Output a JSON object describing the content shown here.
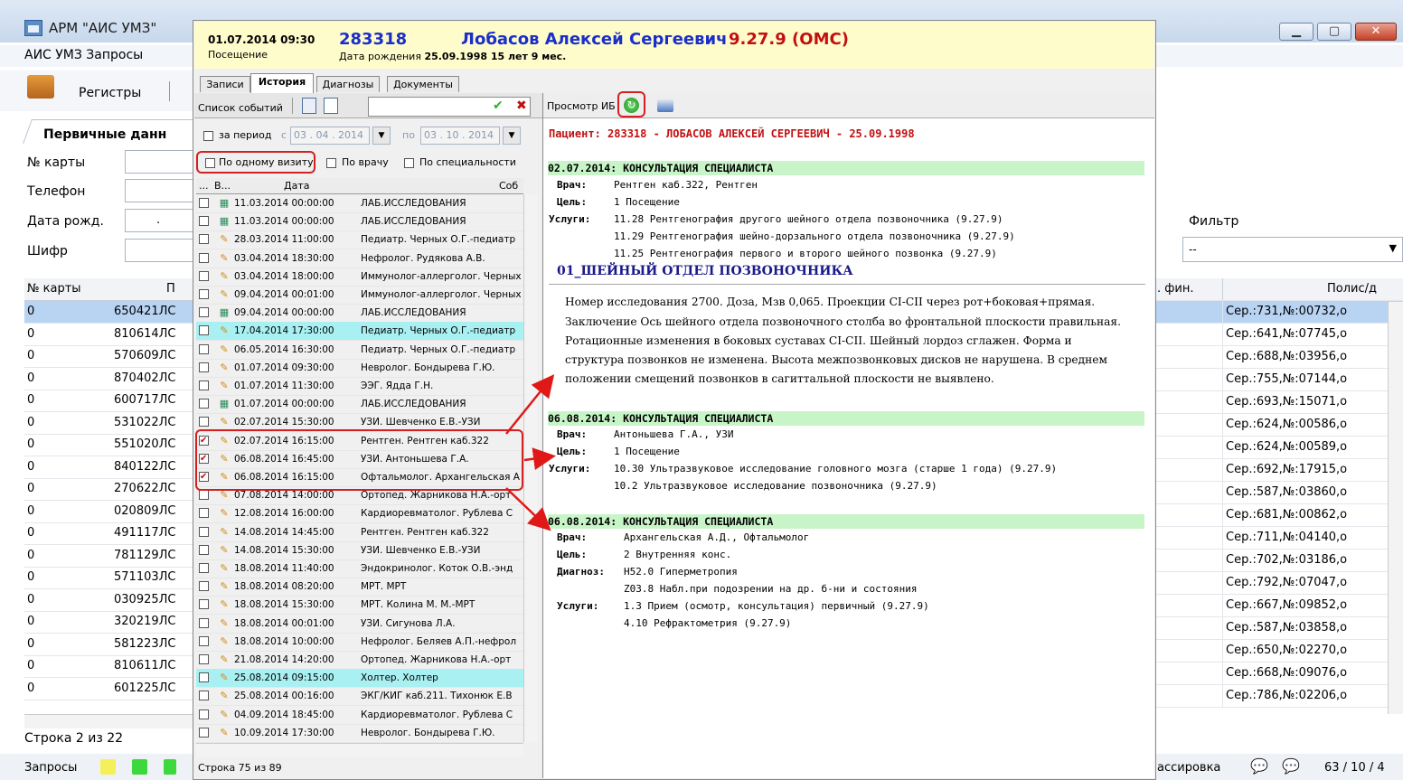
{
  "main_window": {
    "title": "АРМ \"АИС УМЗ\"",
    "menu": "АИС УМЗ  Запросы",
    "toolbar_registry": "Регистры",
    "tab_primary": "Первичные данн",
    "labels": {
      "card": "№ карты",
      "phone": "Телефон",
      "dob": "Дата рожд.",
      "cipher": "Шифр"
    },
    "dob_value": ".",
    "filter_label": "Фильтр",
    "filter_value": "--",
    "grid_headers": {
      "card": "№ карты",
      "pl": "П",
      "fin": ". фин.",
      "policy": "Полис/д"
    },
    "left_rows": [
      {
        "card": "0",
        "code": "650421ЛС",
        "selected": true
      },
      {
        "card": "0",
        "code": "810614ЛС"
      },
      {
        "card": "0",
        "code": "570609ЛС"
      },
      {
        "card": "0",
        "code": "870402ЛС"
      },
      {
        "card": "0",
        "code": "600717ЛС"
      },
      {
        "card": "0",
        "code": "531022ЛС"
      },
      {
        "card": "0",
        "code": "551020ЛС"
      },
      {
        "card": "0",
        "code": "840122ЛС"
      },
      {
        "card": "0",
        "code": "270622ЛС"
      },
      {
        "card": "0",
        "code": "020809ЛС"
      },
      {
        "card": "0",
        "code": "491117ЛС"
      },
      {
        "card": "0",
        "code": "781129ЛС"
      },
      {
        "card": "0",
        "code": "571103ЛС"
      },
      {
        "card": "0",
        "code": "030925ЛС"
      },
      {
        "card": "0",
        "code": "320219ЛС"
      },
      {
        "card": "0",
        "code": "581223ЛС"
      },
      {
        "card": "0",
        "code": "810611ЛС"
      },
      {
        "card": "0",
        "code": "601225ЛС"
      }
    ],
    "policy_rows": [
      "Сер.:731,№:00732,о",
      "Сер.:641,№:07745,о",
      "Сер.:688,№:03956,о",
      "Сер.:755,№:07144,о",
      "Сер.:693,№:15071,о",
      "Сер.:624,№:00586,о",
      "Сер.:624,№:00589,о",
      "Сер.:692,№:17915,о",
      "Сер.:587,№:03860,о",
      "Сер.:681,№:00862,о",
      "Сер.:711,№:04140,о",
      "Сер.:702,№:03186,о",
      "Сер.:792,№:07047,о",
      "Сер.:667,№:09852,о",
      "Сер.:587,№:03858,о",
      "Сер.:650,№:02270,о",
      "Сер.:668,№:09076,о",
      "Сер.:786,№:02206,о"
    ],
    "row_status": "Строка 2 из 22",
    "bottom_left": "Запросы",
    "bottom_right_text": "ассировка",
    "bottom_counter": "63 / 10 / 4"
  },
  "popup": {
    "visit_datetime": "01.07.2014   09:30",
    "visit_type": "Посещение",
    "patient_id": "283318",
    "patient_name": "Лобасов Алексей Сергеевич",
    "program_code": "9.27.9 (ОМС)",
    "dob_label": "Дата рождения",
    "dob_value": "25.09.1998   15 лет 9 мес.",
    "tabs": [
      "Записи",
      "История",
      "Диагнозы",
      "Документы"
    ],
    "active_tab": "История",
    "list_panel": {
      "title": "Список событий",
      "period_label": "за период",
      "from_label": "с",
      "from_value": "03 . 04 . 2014",
      "to_label": "по",
      "to_value": "03 . 10 . 2014",
      "filter_visit": "По одному визиту",
      "filter_doctor": "По врачу",
      "filter_specialty": "По специальности",
      "col_dots": "...",
      "col_v": "В...",
      "col_date": "Дата",
      "col_event": "Соб",
      "rows": [
        {
          "checked": false,
          "icon": "lab",
          "date": "11.03.2014 00:00:00",
          "event": "ЛАБ.ИССЛЕДОВАНИЯ",
          "hl": false
        },
        {
          "checked": false,
          "icon": "lab",
          "date": "11.03.2014 00:00:00",
          "event": "ЛАБ.ИССЛЕДОВАНИЯ",
          "hl": false
        },
        {
          "checked": false,
          "icon": "pen",
          "date": "28.03.2014 11:00:00",
          "event": "Педиатр. Черных О.Г.-педиатр",
          "hl": false
        },
        {
          "checked": false,
          "icon": "pen",
          "date": "03.04.2014 18:30:00",
          "event": "Нефролог. Рудякова А.В.",
          "hl": false
        },
        {
          "checked": false,
          "icon": "pen",
          "date": "03.04.2014 18:00:00",
          "event": "Иммунолог-аллерголог. Черных",
          "hl": false
        },
        {
          "checked": false,
          "icon": "pen",
          "date": "09.04.2014 00:01:00",
          "event": "Иммунолог-аллерголог. Черных",
          "hl": false
        },
        {
          "checked": false,
          "icon": "lab",
          "date": "09.04.2014 00:00:00",
          "event": "ЛАБ.ИССЛЕДОВАНИЯ",
          "hl": false
        },
        {
          "checked": false,
          "icon": "pen",
          "date": "17.04.2014 17:30:00",
          "event": "Педиатр. Черных О.Г.-педиатр",
          "hl": true
        },
        {
          "checked": false,
          "icon": "pen",
          "date": "06.05.2014 16:30:00",
          "event": "Педиатр. Черных О.Г.-педиатр",
          "hl": false
        },
        {
          "checked": false,
          "icon": "pen",
          "date": "01.07.2014 09:30:00",
          "event": "Невролог. Бондырева Г.Ю.",
          "hl": false
        },
        {
          "checked": false,
          "icon": "pen",
          "date": "01.07.2014 11:30:00",
          "event": "ЭЭГ. Ядда Г.Н.",
          "hl": false
        },
        {
          "checked": false,
          "icon": "lab",
          "date": "01.07.2014 00:00:00",
          "event": "ЛАБ.ИССЛЕДОВАНИЯ",
          "hl": false
        },
        {
          "checked": false,
          "icon": "pen",
          "date": "02.07.2014 15:30:00",
          "event": "УЗИ. Шевченко Е.В.-УЗИ",
          "hl": false
        },
        {
          "checked": true,
          "icon": "pen",
          "date": "02.07.2014 16:15:00",
          "event": "Рентген. Рентген каб.322",
          "hl": false
        },
        {
          "checked": true,
          "icon": "pen",
          "date": "06.08.2014 16:45:00",
          "event": "УЗИ. Антоньшева Г.А.",
          "hl": false
        },
        {
          "checked": true,
          "icon": "pen",
          "date": "06.08.2014 16:15:00",
          "event": "Офтальмолог. Архангельская А",
          "hl": false
        },
        {
          "checked": false,
          "icon": "pen",
          "date": "07.08.2014 14:00:00",
          "event": "Ортопед. Жарникова Н.А.-орт",
          "hl": false
        },
        {
          "checked": false,
          "icon": "pen",
          "date": "12.08.2014 16:00:00",
          "event": "Кардиоревматолог. Рублева С",
          "hl": false
        },
        {
          "checked": false,
          "icon": "pen",
          "date": "14.08.2014 14:45:00",
          "event": "Рентген. Рентген каб.322",
          "hl": false
        },
        {
          "checked": false,
          "icon": "pen",
          "date": "14.08.2014 15:30:00",
          "event": "УЗИ. Шевченко Е.В.-УЗИ",
          "hl": false
        },
        {
          "checked": false,
          "icon": "pen",
          "date": "18.08.2014 11:40:00",
          "event": "Эндокринолог. Коток О.В.-энд",
          "hl": false
        },
        {
          "checked": false,
          "icon": "pen",
          "date": "18.08.2014 08:20:00",
          "event": "МРТ. МРТ",
          "hl": false
        },
        {
          "checked": false,
          "icon": "pen",
          "date": "18.08.2014 15:30:00",
          "event": "МРТ. Колина М. М.-МРТ",
          "hl": false
        },
        {
          "checked": false,
          "icon": "pen",
          "date": "18.08.2014 00:01:00",
          "event": "УЗИ. Сигунова Л.А.",
          "hl": false
        },
        {
          "checked": false,
          "icon": "pen",
          "date": "18.08.2014 10:00:00",
          "event": "Нефролог. Беляев А.П.-нефрол",
          "hl": false
        },
        {
          "checked": false,
          "icon": "pen",
          "date": "21.08.2014 14:20:00",
          "event": "Ортопед. Жарникова Н.А.-орт",
          "hl": false
        },
        {
          "checked": false,
          "icon": "pen",
          "date": "25.08.2014 09:15:00",
          "event": "Холтер. Холтер",
          "hl": true
        },
        {
          "checked": false,
          "icon": "pen",
          "date": "25.08.2014 00:16:00",
          "event": "ЭКГ/КИГ каб.211. Тихонюк Е.В",
          "hl": false
        },
        {
          "checked": false,
          "icon": "pen",
          "date": "04.09.2014 18:45:00",
          "event": "Кардиоревматолог. Рублева С",
          "hl": false
        },
        {
          "checked": false,
          "icon": "pen",
          "date": "10.09.2014 17:30:00",
          "event": "Невролог. Бондырева Г.Ю.",
          "hl": false
        }
      ],
      "status": "Строка 75 из 89"
    },
    "view_panel": {
      "title": "Просмотр ИБ",
      "patient_line": "Пациент: 283318 - ЛОБАСОВ АЛЕКСЕЙ СЕРГЕЕВИЧ - 25.09.1998",
      "records": [
        {
          "heading": "02.07.2014: КОНСУЛЬТАЦИЯ СПЕЦИАЛИСТА",
          "doctor_label": "Врач:",
          "doctor": "Рентген каб.322, Рентген",
          "goal_label": "Цель:",
          "goal": "1 Посещение",
          "services_label": "Услуги:",
          "services": [
            "11.28 Рентгенография другого шейного отдела позвоночника (9.27.9)",
            "11.29 Рентгенография шейно-дорзального отдела позвоночника (9.27.9)",
            "11.25 Рентгенография первого и второго шейного позвонка (9.27.9)"
          ],
          "exam_title": "01_ШЕЙНЫЙ ОТДЕЛ ПОЗВОНОЧНИКА",
          "exam_text": [
            "Номер исследования 2700. Доза, Мзв 0,065. Проекции CI-CII через рот+боковая+прямая.",
            "Заключение Ось шейного отдела позвоночного столба во фронтальной плоскости правильная.",
            "Ротационные изменения в боковых суставах CI-CII. Шейный лордоз сглажен. Форма и",
            "структура позвонков не изменена. Высота межпозвонковых дисков не нарушена. В среднем",
            "положении смещений позвонков в сагиттальной плоскости не выявлено."
          ]
        },
        {
          "heading": "06.08.2014: КОНСУЛЬТАЦИЯ СПЕЦИАЛИСТА",
          "doctor_label": "Врач:",
          "doctor": "Антоньшева Г.А., УЗИ",
          "goal_label": "Цель:",
          "goal": "1 Посещение",
          "services_label": "Услуги:",
          "services": [
            "10.30 Ультразвуковое исследование головного мозга (старше 1 года) (9.27.9)",
            "10.2 Ультразвуковое исследование позвоночника (9.27.9)"
          ]
        },
        {
          "heading": "06.08.2014: КОНСУЛЬТАЦИЯ СПЕЦИАЛИСТА",
          "doctor_label": "Врач:",
          "doctor": "Архангельская А.Д., Офтальмолог",
          "goal_label": "Цель:",
          "goal": "2 Внутренняя конс.",
          "diagnosis_label": "Диагноз:",
          "diagnoses": [
            "H52.0 Гиперметропия",
            "Z03.8 Набл.при подозрении на др. б-ни и состояния"
          ],
          "services_label": "Услуги:",
          "services": [
            "1.3 Прием (осмотр, консультация) первичный (9.27.9)",
            "4.10 Рефрактометрия (9.27.9)"
          ]
        }
      ]
    }
  },
  "colors": {
    "accent_red": "#d42020",
    "name_blue": "#1a2fc8",
    "section_green": "#c8f5c8",
    "row_highlight": "#a9f0f2",
    "header_yellow": "#fffccc"
  }
}
